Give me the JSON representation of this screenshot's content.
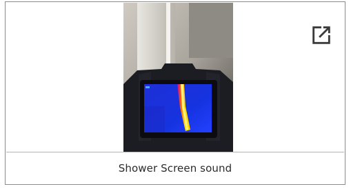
{
  "card": {
    "caption": "Shower Screen sound",
    "expand_icon": "open-in-new-icon"
  }
}
